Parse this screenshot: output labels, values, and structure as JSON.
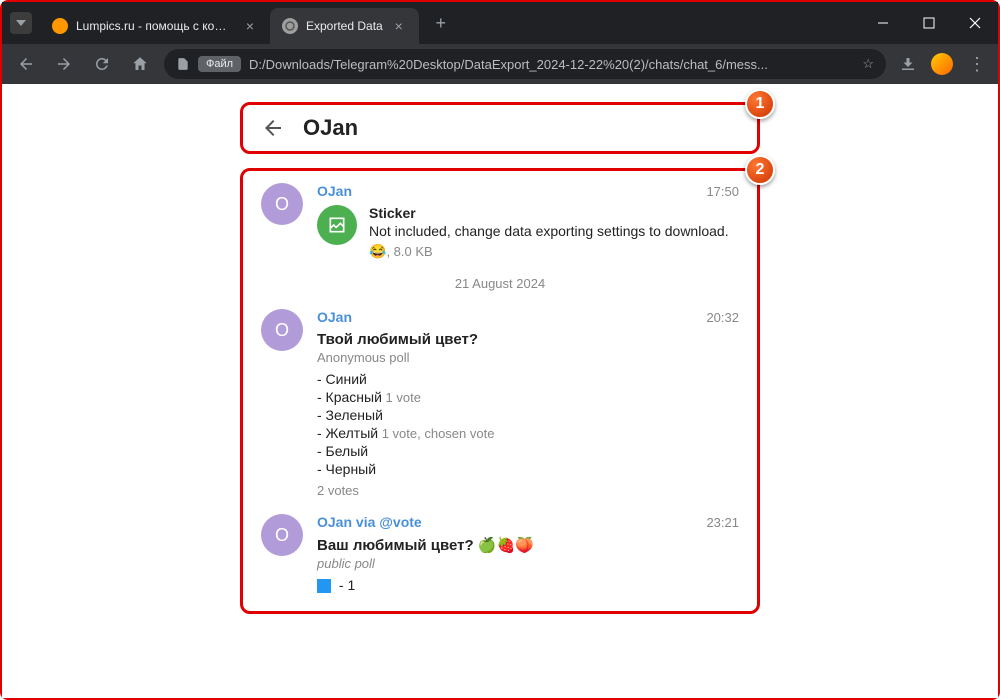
{
  "browser": {
    "tabs": [
      {
        "title": "Lumpics.ru - помощь с компь",
        "active": false
      },
      {
        "title": "Exported Data",
        "active": true
      }
    ],
    "address": {
      "file_label": "Файл",
      "url": "D:/Downloads/Telegram%20Desktop/DataExport_2024-12-22%20(2)/chats/chat_6/mess..."
    }
  },
  "chat": {
    "name": "OJan",
    "messages": [
      {
        "sender": "OJan",
        "time": "17:50",
        "sticker": {
          "title": "Sticker",
          "desc": "Not included, change data exporting settings to download.",
          "emoji": "😂",
          "size": ", 8.0 KB"
        }
      }
    ],
    "date_separator": "21 August 2024",
    "poll1": {
      "sender": "OJan",
      "time": "20:32",
      "title": "Твой любимый цвет?",
      "type": "Anonymous poll",
      "options": [
        {
          "label": "- Синий",
          "meta": ""
        },
        {
          "label": "- Красный",
          "meta": " 1 vote"
        },
        {
          "label": "- Зеленый",
          "meta": ""
        },
        {
          "label": "- Желтый",
          "meta": " 1 vote, chosen vote"
        },
        {
          "label": "- Белый",
          "meta": ""
        },
        {
          "label": "- Черный",
          "meta": ""
        }
      ],
      "total": "2 votes"
    },
    "poll2": {
      "sender": "OJan via @vote",
      "time": "23:21",
      "title": "Ваш любимый цвет? 🍏🍓🍑",
      "type": "public poll",
      "option1": " - 1"
    }
  },
  "callouts": {
    "c1": "1",
    "c2": "2"
  }
}
